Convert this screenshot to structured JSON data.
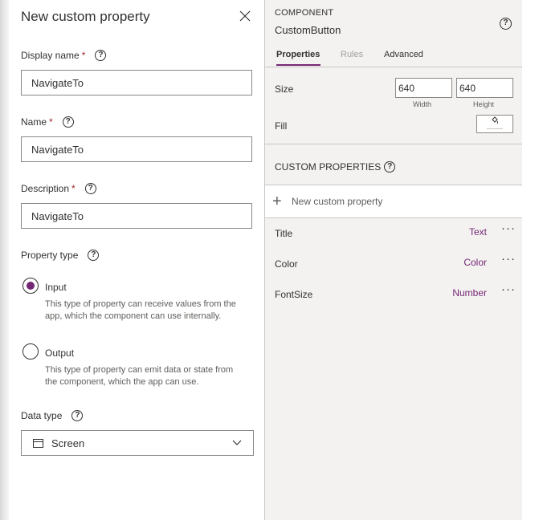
{
  "dialog": {
    "title": "New custom property",
    "fields": {
      "display_name": {
        "label": "Display name",
        "required_mark": "*",
        "value": "NavigateTo"
      },
      "name": {
        "label": "Name",
        "required_mark": "*",
        "value": "NavigateTo"
      },
      "description": {
        "label": "Description",
        "required_mark": "*",
        "value": "NavigateTo"
      }
    },
    "property_type": {
      "label": "Property type",
      "options": [
        {
          "label": "Input",
          "description": "This type of property can receive values from the app, which the component can use internally.",
          "selected": true
        },
        {
          "label": "Output",
          "description": "This type of property can emit data or state from the component, which the app can use.",
          "selected": false
        }
      ]
    },
    "data_type": {
      "label": "Data type",
      "value": "Screen",
      "icon": "screen-icon"
    }
  },
  "pane": {
    "component_kind": "COMPONENT",
    "component_name": "CustomButton",
    "tabs": [
      {
        "label": "Properties",
        "state": "active"
      },
      {
        "label": "Rules",
        "state": "disabled"
      },
      {
        "label": "Advanced",
        "state": "normal"
      }
    ],
    "size": {
      "label": "Size",
      "width": "640",
      "height": "640",
      "width_caption": "Width",
      "height_caption": "Height"
    },
    "fill": {
      "label": "Fill",
      "icon": "paint-bucket-icon"
    },
    "custom_properties": {
      "heading": "CUSTOM PROPERTIES",
      "new_label": "New custom property",
      "items": [
        {
          "name": "Title",
          "type": "Text"
        },
        {
          "name": "Color",
          "type": "Color"
        },
        {
          "name": "FontSize",
          "type": "Number"
        }
      ]
    }
  },
  "colors": {
    "accent": "#742774",
    "required": "#a4262c",
    "pane_bg": "#f3f2f1",
    "border": "#8a8886"
  }
}
